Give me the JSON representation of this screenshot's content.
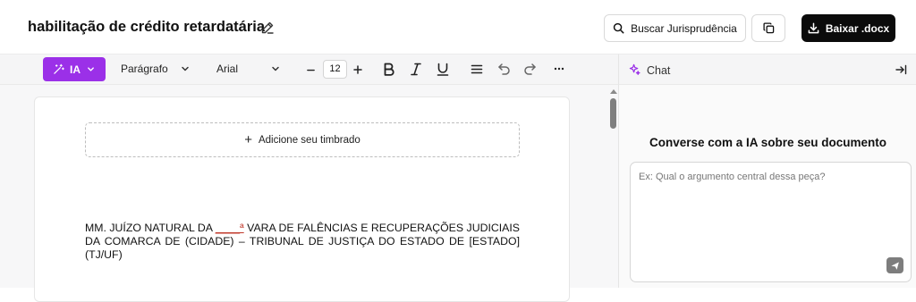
{
  "header": {
    "doc_title": "habilitação de crédito retardatária",
    "search_label": "Buscar Jurisprudência",
    "download_label": "Baixar .docx"
  },
  "toolbar": {
    "ia_label": "IA",
    "paragraph_style": "Parágrafo",
    "font_family": "Arial",
    "font_size": "12",
    "icons": [
      "wand-icon",
      "minus-icon",
      "plus-icon",
      "bold-icon",
      "italic-icon",
      "underline-icon",
      "align-icon",
      "undo-icon",
      "redo-icon",
      "more-icon"
    ]
  },
  "chat": {
    "tab_label": "Chat",
    "title": "Converse com a IA sobre seu documento",
    "input_placeholder": "Ex: Qual o argumento central dessa peça?"
  },
  "document": {
    "letterhead_label": "Adicione seu timbrado",
    "paragraph_prefix": "MM. JUÍZO NATURAL DA ",
    "paragraph_blank": "____ª",
    "paragraph_suffix": " VARA DE FALÊNCIAS E RECUPERAÇÕES JUDICIAIS DA COMARCA DE (CIDADE) – TRIBUNAL DE JUSTIÇA DO ESTADO DE [ESTADO] (TJ/UF)"
  },
  "colors": {
    "accent_purple": "#9b30e8",
    "download_button": "#0b0b0b",
    "blank_red": "#c0392b"
  }
}
